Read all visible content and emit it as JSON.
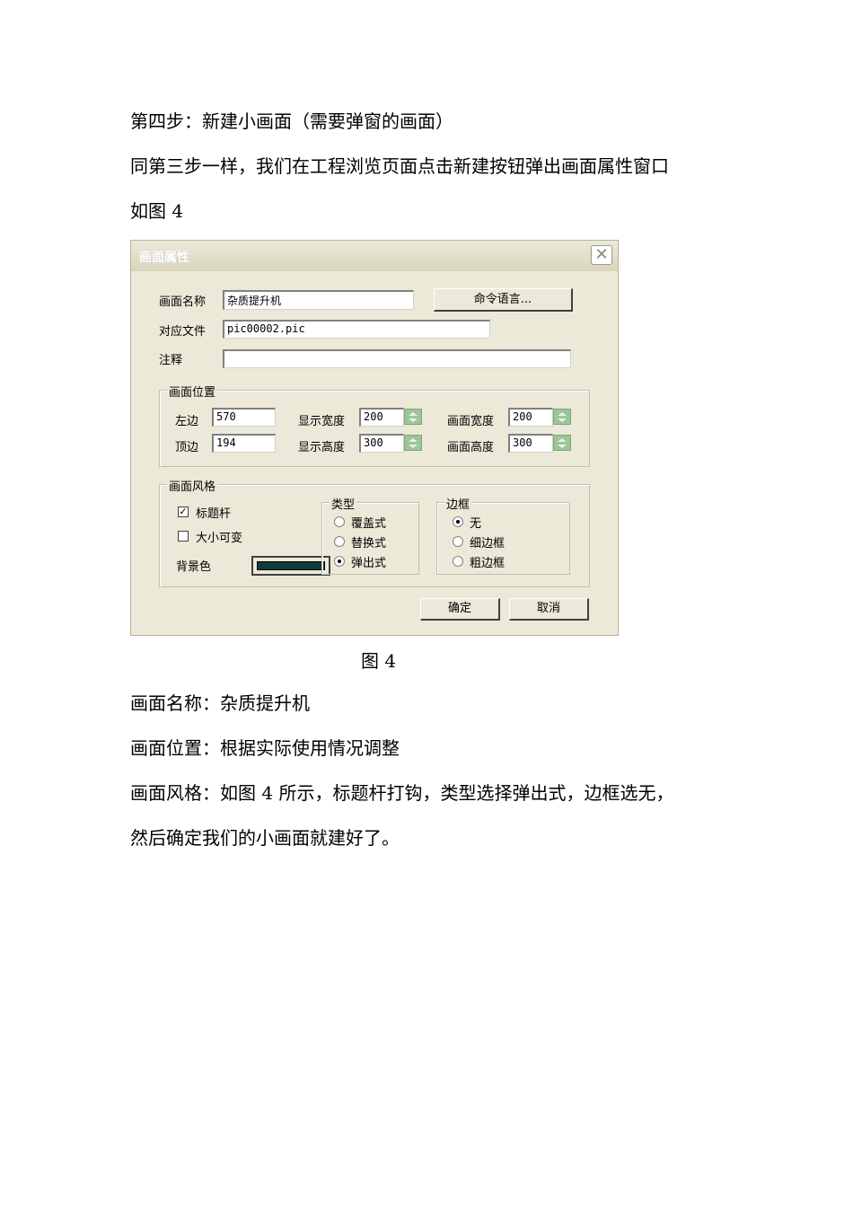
{
  "document": {
    "para1": "第四步：新建小画面（需要弹窗的画面）",
    "para2": "同第三步一样，我们在工程浏览页面点击新建按钮弹出画面属性窗口",
    "para3": "如图 4",
    "caption": "图 4",
    "para4": "画面名称：杂质提升机",
    "para5": "画面位置：根据实际使用情况调整",
    "para6": "画面风格：如图 4 所示，标题杆打钩，类型选择弹出式，边框选无，",
    "para7": "然后确定我们的小画面就建好了。"
  },
  "dialog": {
    "title": "画面属性",
    "close_icon": "close-icon",
    "name_label": "画面名称",
    "name_value": "杂质提升机",
    "command_button": "命令语言...",
    "file_label": "对应文件",
    "file_value": "pic00002.pic",
    "comment_label": "注释",
    "comment_value": "",
    "position_group": {
      "title": "画面位置",
      "left_label": "左边",
      "left_value": "570",
      "top_label": "顶边",
      "top_value": "194",
      "display_width_label": "显示宽度",
      "display_width_value": "200",
      "display_height_label": "显示高度",
      "display_height_value": "300",
      "canvas_width_label": "画面宽度",
      "canvas_width_value": "200",
      "canvas_height_label": "画面高度",
      "canvas_height_value": "300"
    },
    "style_group": {
      "title": "画面风格",
      "titlebar_label": "标题杆",
      "titlebar_checked": true,
      "resizable_label": "大小可变",
      "resizable_checked": false,
      "bgcolor_label": "背景色",
      "bgcolor": "#0d3b3b",
      "type_group": {
        "title": "类型",
        "options": [
          "覆盖式",
          "替换式",
          "弹出式"
        ],
        "selected": "弹出式"
      },
      "border_group": {
        "title": "边框",
        "options": [
          "无",
          "细边框",
          "粗边框"
        ],
        "selected": "无"
      }
    },
    "ok_button": "确定",
    "cancel_button": "取消"
  }
}
